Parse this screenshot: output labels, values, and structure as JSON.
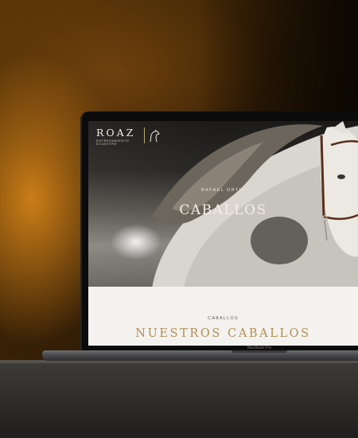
{
  "scene": {
    "device_label": "MacBook Pro"
  },
  "site": {
    "logo": {
      "name": "ROAZ",
      "tagline": "ENTRENAMIENTO ECUESTRE"
    },
    "hero": {
      "kicker": "RAFAEL ORTIZ",
      "title": "CABALLOS"
    },
    "section": {
      "kicker": "CABALLOS",
      "title": "NUESTROS CABALLOS"
    }
  },
  "colors": {
    "accent_gold": "#b28f53",
    "hero_text": "#f3efe6",
    "section_bg": "#f4f2ee"
  },
  "icons": {
    "logo_mark": "horse-head-icon"
  }
}
